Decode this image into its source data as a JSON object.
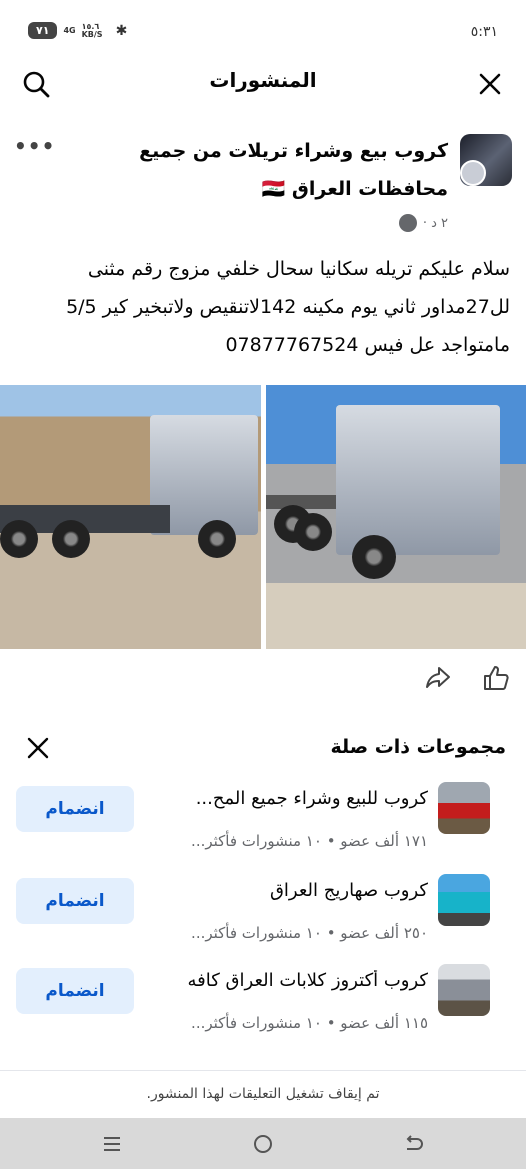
{
  "status": {
    "time": "٥:٣١",
    "battery": "٧١",
    "network": "4G",
    "speed": "١٥.٦ KB/S"
  },
  "header": {
    "title": "المنشورات",
    "search_icon": "search-icon",
    "close_icon": "close-icon"
  },
  "post": {
    "title": "كروب بيع وشراء تريلات من جميع محافظات العراق 🇮🇶",
    "time": "٢ د ·",
    "privacy_icon": "globe-icon",
    "text": "سلام عليكم تريله سكانيا سحال خلفي مزوج رقم مثنى لل27مداور ثاني يوم مكينه 142لاتنقيص ولاتبخير كير 5/5 مامتواجد عل فيس 07877767524"
  },
  "actions": {
    "like_icon": "like-icon",
    "share_icon": "share-icon"
  },
  "related": {
    "title": "مجموعات ذات صلة",
    "groups": [
      {
        "name": "كروب للبيع وشراء جميع المح...",
        "meta": "١٧١ ألف عضو • ١٠ منشورات فأكثر...",
        "join": "انضمام"
      },
      {
        "name": "كروب صهاريج العراق",
        "meta": "٢٥٠ ألف عضو • ١٠ منشورات فأكثر...",
        "join": "انضمام"
      },
      {
        "name": "كروب أكتروز كلابات العراق كافه",
        "meta": "١١٥ ألف عضو • ١٠ منشورات فأكثر...",
        "join": "انضمام"
      }
    ]
  },
  "notice": "تم إيقاف تشغيل التعليقات لهذا المنشور.",
  "navbar": {
    "recent_icon": "recent-apps-icon",
    "home_icon": "home-icon",
    "back_icon": "back-icon"
  },
  "colors": {
    "accent": "#0a58ca",
    "join_bg": "#e3effd",
    "secondary_text": "#65676b"
  }
}
